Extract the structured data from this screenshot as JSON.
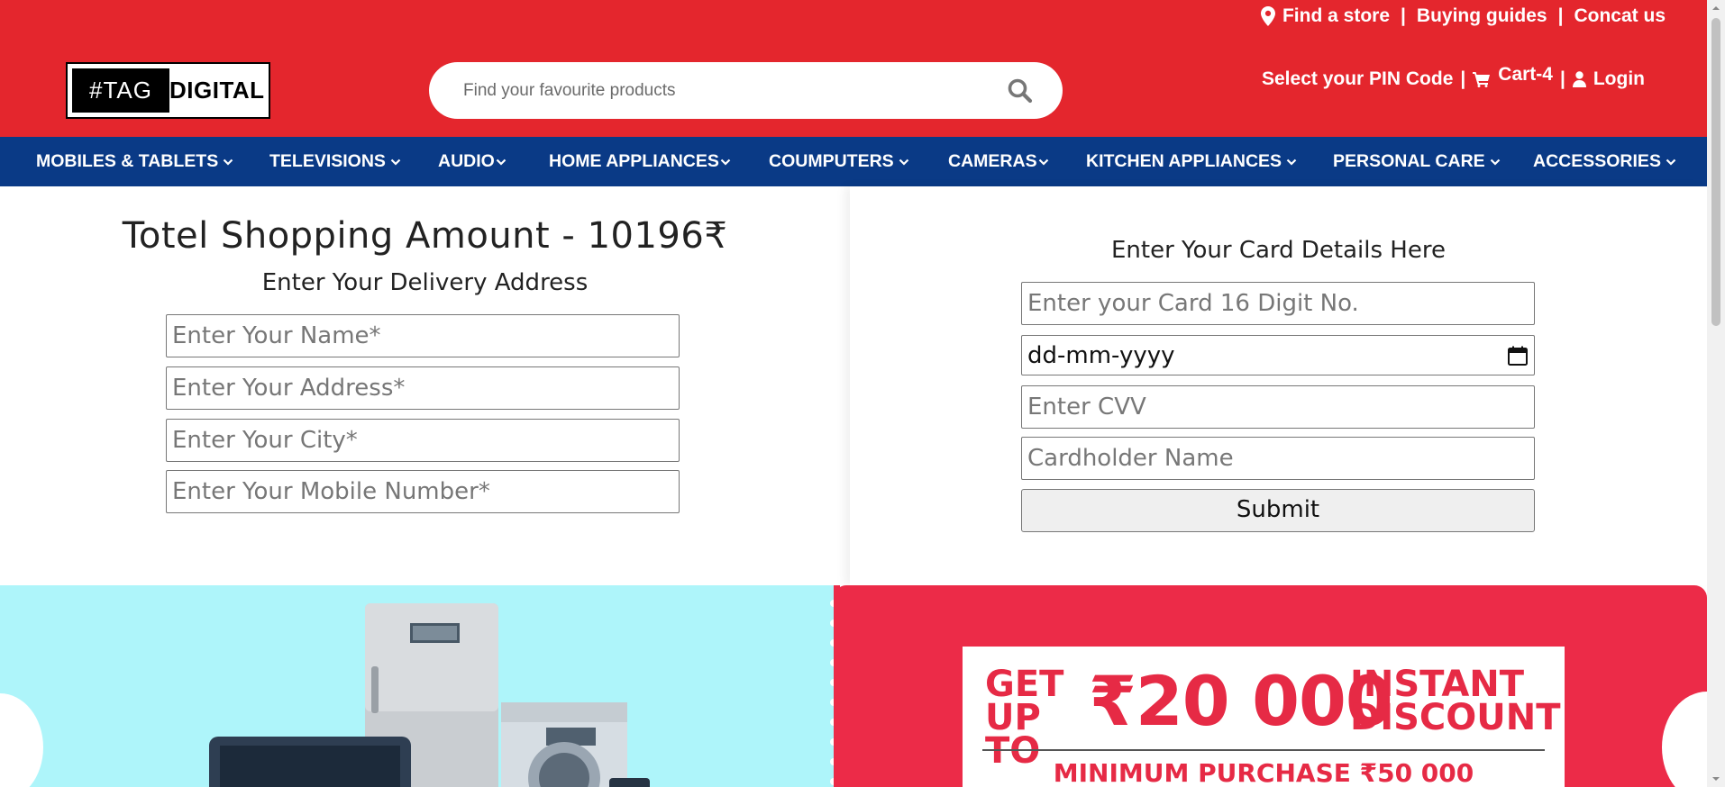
{
  "header": {
    "top_links": [
      "Find a store",
      "Buying guides",
      "Concat us"
    ],
    "logo_left": "#TAG",
    "logo_right": "DIGITAL",
    "search_placeholder": "Find your favourite products",
    "pin_label": "Select your PIN Code",
    "cart_label": "Cart-4",
    "login_label": "Login"
  },
  "nav": {
    "items": [
      "MOBILES & TABLETS",
      "TELEVISIONS",
      "AUDIO",
      "HOME APPLIANCES",
      "COUMPUTERS",
      "CAMERAS",
      "KITCHEN APPLIANCES",
      "PERSONAL CARE",
      "ACCESSORIES"
    ]
  },
  "address": {
    "total": "Totel Shopping Amount - 10196₹",
    "heading": "Enter Your Delivery Address",
    "name_placeholder": "Enter Your Name*",
    "address_placeholder": "Enter Your Address*",
    "city_placeholder": "Enter Your City*",
    "mobile_placeholder": "Enter Your Mobile Number*"
  },
  "card": {
    "heading": "Enter Your Card Details Here",
    "number_placeholder": "Enter your Card 16 Digit No.",
    "date_value": "dd-mm-yyyy",
    "cvv_placeholder": "Enter CVV",
    "holder_placeholder": "Cardholder Name",
    "submit_label": "Submit"
  },
  "promo": {
    "get_up_to": "GET UP TO",
    "amount": "₹20 000",
    "instant_discount": "INSTANT DISCOUNT",
    "minimum": "MINIMUM PURCHASE ₹50 000"
  },
  "colors": {
    "header_red": "#e4262d",
    "nav_blue": "#0a3a86",
    "banner_cyan": "#aef5fa",
    "banner_red": "#ec2b48"
  }
}
